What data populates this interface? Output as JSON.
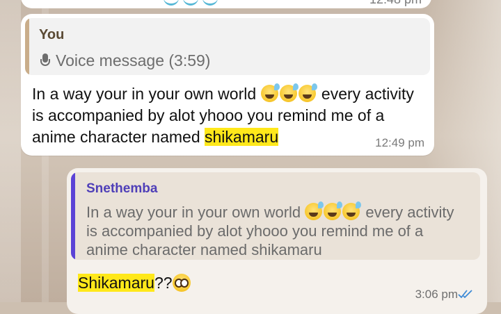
{
  "previous_message": {
    "time": "12:48 pm"
  },
  "incoming_message": {
    "quoted": {
      "sender": "You",
      "voice_label": "Voice message (3:59)"
    },
    "text_before_emojis": "In a way your in your own world",
    "text_after_emojis": " every activity is accompanied by alot yhooo you remind me of a anime character named ",
    "highlighted_text": "shikamaru",
    "emojis": [
      "grinning-sweat-emoji",
      "grinning-sweat-emoji",
      "grinning-sweat-emoji"
    ],
    "time": "12:49 pm"
  },
  "outgoing_message": {
    "quoted": {
      "sender": "Snethemba",
      "text_before_emojis": "In a way your in your own world",
      "text_after_emojis": " every activity is accompanied by alot yhooo you remind me of a anime character named shikamaru"
    },
    "highlighted_text": "Shikamaru",
    "text_after_highlight": "??",
    "emoji": "pleading-face-emoji",
    "time": "3:06 pm",
    "status": "read"
  },
  "colors": {
    "highlight": "#ffe81a",
    "quote_bar_outgoing": "#5b43d6",
    "quote_bar_incoming": "#c9ad8a",
    "read_ticks": "#3d8ad6"
  }
}
